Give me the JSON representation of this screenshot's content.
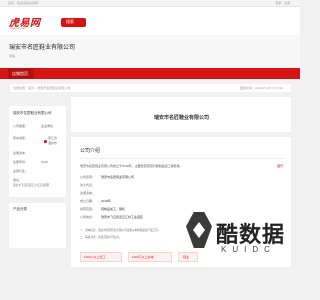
{
  "topbar": {
    "left_text": "您好，欢迎来到虎易网",
    "right_text": "登录 · 注册"
  },
  "site": {
    "logo": "虎易网",
    "logo_sub": "cocooz.com",
    "search_label": "搜索"
  },
  "hero": {
    "title": "瑞安市名匠鞋业有限公司",
    "meta": "商铺"
  },
  "nav": {
    "active_tab": "店铺首页"
  },
  "breadcrumb": {
    "path": "当前位置：首页 > 瑞安市名匠鞋业有限公司",
    "date": "更新时间：2020-07-23 17:47:22"
  },
  "side": {
    "title": "瑞安市名匠鞋业有限公司",
    "rows": [
      {
        "label": "公司类型：",
        "value": "企业单位"
      },
      {
        "label": "所在地区：",
        "value": "浙江省"
      },
      {
        "label": "",
        "value": "温州市"
      },
      {
        "label": "注册资本：",
        "value": ""
      },
      {
        "label": "注册年份：",
        "value": "2018"
      },
      {
        "label": "主营行业：",
        "value": ""
      },
      {
        "label": "地址：",
        "value": "瑞安市飞云街道云江村工业园区"
      }
    ],
    "products_title": "产品分类"
  },
  "main": {
    "company_name": "瑞安市名匠鞋业有限公司"
  },
  "profile": {
    "heading": "公司介绍",
    "summary": "瑞安市名匠鞋业有限公司成立于2018年，主要经营范围为鞋制品加工销售等。",
    "more_link": "展开",
    "fields": [
      {
        "key": "公司名称：",
        "value": "瑞安市名匠鞋业有限公司"
      },
      {
        "key": "法人代表：",
        "value": ""
      },
      {
        "key": "注册资本：",
        "value": ""
      },
      {
        "key": "成立日期：",
        "value": "2018年"
      },
      {
        "key": "经营范围：",
        "value": "鞋制品加工、销售"
      },
      {
        "key": "公司地址：",
        "value": "瑞安市飞云街道云江村工业园区"
      }
    ],
    "description": [
      "一、基本信息：瑞安市名匠鞋业有限公司主要从事鞋制品生产加工等。",
      "二、联系方式：详见页面公司信息。"
    ],
    "stats": [
      "1000人以上员工",
      "1000万以上资本",
      "鞋业"
    ]
  },
  "watermark": {
    "glyphs": "酷数据",
    "sub": "KUIDC"
  },
  "colors": {
    "brand_red": "#d71414",
    "page_bg": "#f1f1f1"
  }
}
